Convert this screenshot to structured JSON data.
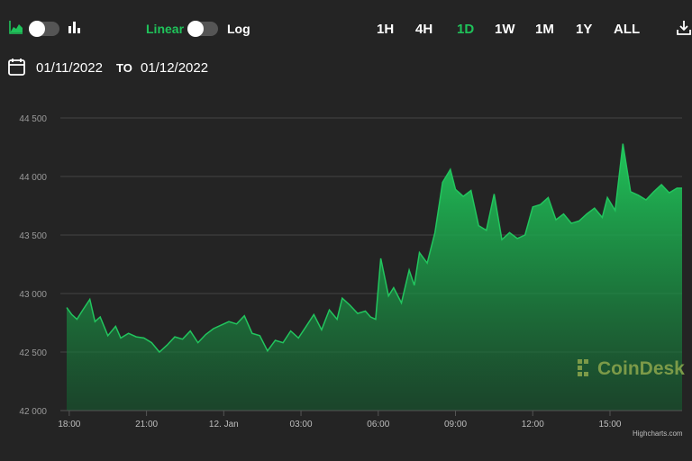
{
  "controls": {
    "chart_mode_area_icon": "area-chart-icon",
    "chart_mode_bar_icon": "bar-chart-icon",
    "scale_linear_label": "Linear",
    "scale_log_label": "Log",
    "download_icon": "download-icon"
  },
  "ranges": [
    {
      "label": "1H",
      "active": false
    },
    {
      "label": "4H",
      "active": false
    },
    {
      "label": "1D",
      "active": true
    },
    {
      "label": "1W",
      "active": false
    },
    {
      "label": "1M",
      "active": false
    },
    {
      "label": "1Y",
      "active": false
    },
    {
      "label": "ALL",
      "active": false
    }
  ],
  "date_range": {
    "calendar_icon": "calendar-icon",
    "from": "01/11/2022",
    "to_label": "TO",
    "to": "01/12/2022"
  },
  "watermark": {
    "text": "CoinDesk"
  },
  "credit": "Highcharts.com",
  "colors": {
    "accent": "#1fc35a",
    "line": "#22c55e",
    "background": "#242424"
  },
  "chart_data": {
    "type": "area",
    "grid": true,
    "ylim": [
      42000,
      44500
    ],
    "y_ticks": [
      "42 000",
      "42 500",
      "43 000",
      "43 500",
      "44 000",
      "44 500"
    ],
    "x_ticks": [
      "18:00",
      "21:00",
      "12. Jan",
      "03:00",
      "06:00",
      "09:00",
      "12:00",
      "15:00"
    ],
    "x_tick_hours": [
      18,
      21,
      24,
      27,
      30,
      33,
      36,
      39
    ],
    "xlim_hours": [
      17.9,
      41.8
    ],
    "series": [
      {
        "x": [
          17.9,
          18.1,
          18.3,
          18.5,
          18.8,
          19.0,
          19.2,
          19.5,
          19.8,
          20.0,
          20.3,
          20.6,
          20.9,
          21.2,
          21.5,
          21.8,
          22.1,
          22.4,
          22.7,
          23.0,
          23.3,
          23.6,
          23.9,
          24.2,
          24.5,
          24.8,
          25.1,
          25.4,
          25.7,
          26.0,
          26.3,
          26.6,
          26.9,
          27.2,
          27.5,
          27.8,
          28.1,
          28.4,
          28.6,
          28.9,
          29.2,
          29.5,
          29.7,
          29.9,
          30.1,
          30.4,
          30.6,
          30.9,
          31.2,
          31.4,
          31.6,
          31.9,
          32.2,
          32.5,
          32.8,
          33.0,
          33.3,
          33.6,
          33.9,
          34.2,
          34.5,
          34.8,
          35.1,
          35.4,
          35.7,
          36.0,
          36.3,
          36.6,
          36.9,
          37.2,
          37.5,
          37.8,
          38.1,
          38.4,
          38.7,
          38.9,
          39.2,
          39.5,
          39.8,
          40.1,
          40.4,
          40.7,
          41.0,
          41.3,
          41.6,
          41.8
        ],
        "y": [
          42880,
          42820,
          42780,
          42850,
          42950,
          42760,
          42800,
          42640,
          42720,
          42620,
          42660,
          42630,
          42620,
          42580,
          42500,
          42560,
          42630,
          42610,
          42680,
          42580,
          42650,
          42700,
          42730,
          42760,
          42740,
          42810,
          42660,
          42640,
          42510,
          42600,
          42580,
          42680,
          42620,
          42720,
          42820,
          42690,
          42860,
          42780,
          42960,
          42900,
          42830,
          42850,
          42800,
          42780,
          43300,
          42980,
          43050,
          42920,
          43200,
          43070,
          43350,
          43260,
          43520,
          43950,
          44060,
          43890,
          43830,
          43880,
          43580,
          43540,
          43850,
          43460,
          43520,
          43470,
          43500,
          43740,
          43760,
          43820,
          43630,
          43680,
          43600,
          43620,
          43680,
          43730,
          43650,
          43820,
          43710,
          44280,
          43870,
          43840,
          43800,
          43870,
          43930,
          43860,
          43900,
          43900
        ]
      }
    ]
  }
}
